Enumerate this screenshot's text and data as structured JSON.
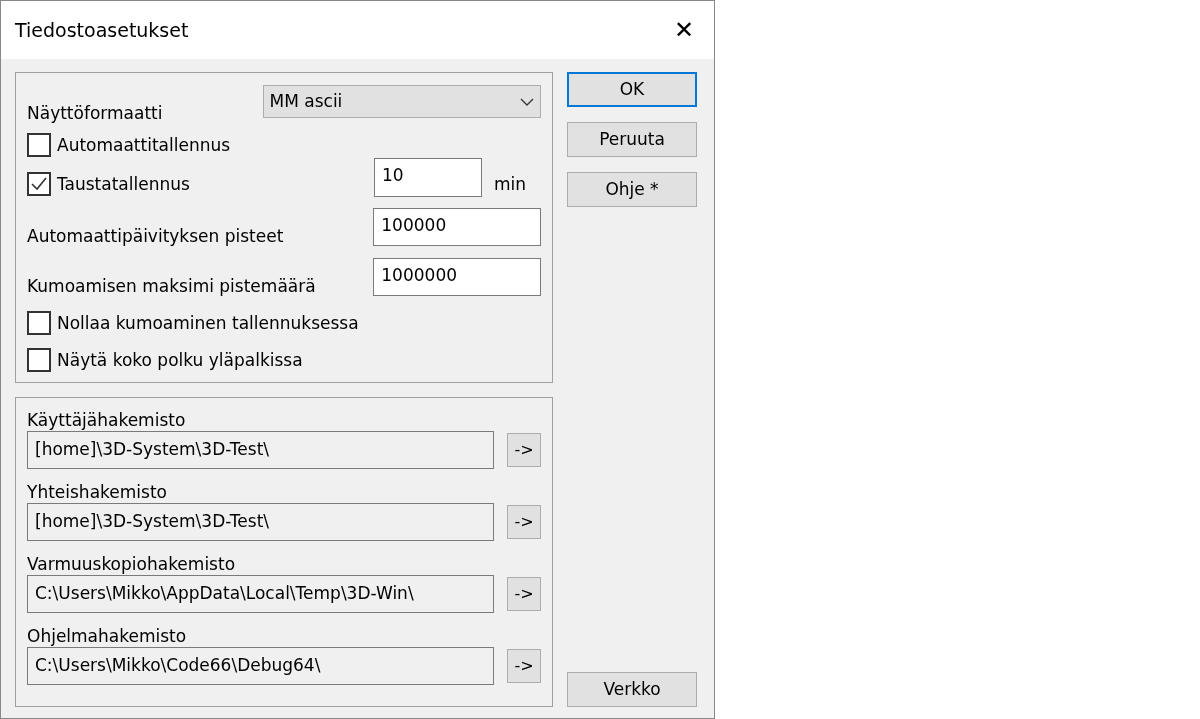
{
  "window": {
    "title": "Tiedostoasetukset",
    "close": "✕"
  },
  "settings": [
    {
      "kind": "select",
      "label": "Näyttöformaatti",
      "value": "MM ascii"
    },
    {
      "kind": "checkbox",
      "label": "Automaattitallennus",
      "checked": false
    },
    {
      "kind": "checkbox",
      "label": "Taustatallennus",
      "checked": true,
      "value": "10",
      "unit": "min"
    },
    {
      "kind": "field",
      "label": "Automaattipäivityksen pisteet",
      "value": "100000"
    },
    {
      "kind": "field",
      "label": "Kumoamisen maksimi pistemäärä",
      "value": "1000000"
    },
    {
      "kind": "checkbox",
      "label": "Nollaa kumoaminen tallennuksessa",
      "checked": false
    },
    {
      "kind": "checkbox",
      "label": "Näytä koko polku yläpalkissa",
      "checked": false
    }
  ],
  "directories": [
    {
      "label": "Käyttäjähakemisto",
      "value": "[home]\\3D-System\\3D-Test\\",
      "button": "->"
    },
    {
      "label": "Yhteishakemisto",
      "value": "[home]\\3D-System\\3D-Test\\",
      "button": "->"
    },
    {
      "label": "Varmuuskopiohakemisto",
      "value": "C:\\Users\\Mikko\\AppData\\Local\\Temp\\3D-Win\\",
      "button": "->"
    },
    {
      "label": "Ohjelmahakemisto",
      "value": "C:\\Users\\Mikko\\Code66\\Debug64\\",
      "button": "->"
    }
  ],
  "buttons": [
    {
      "label": "OK",
      "default": true
    },
    {
      "label": "Peruuta",
      "default": false
    },
    {
      "label": "Ohje *",
      "default": false
    }
  ],
  "bottom_button": "Verkko"
}
